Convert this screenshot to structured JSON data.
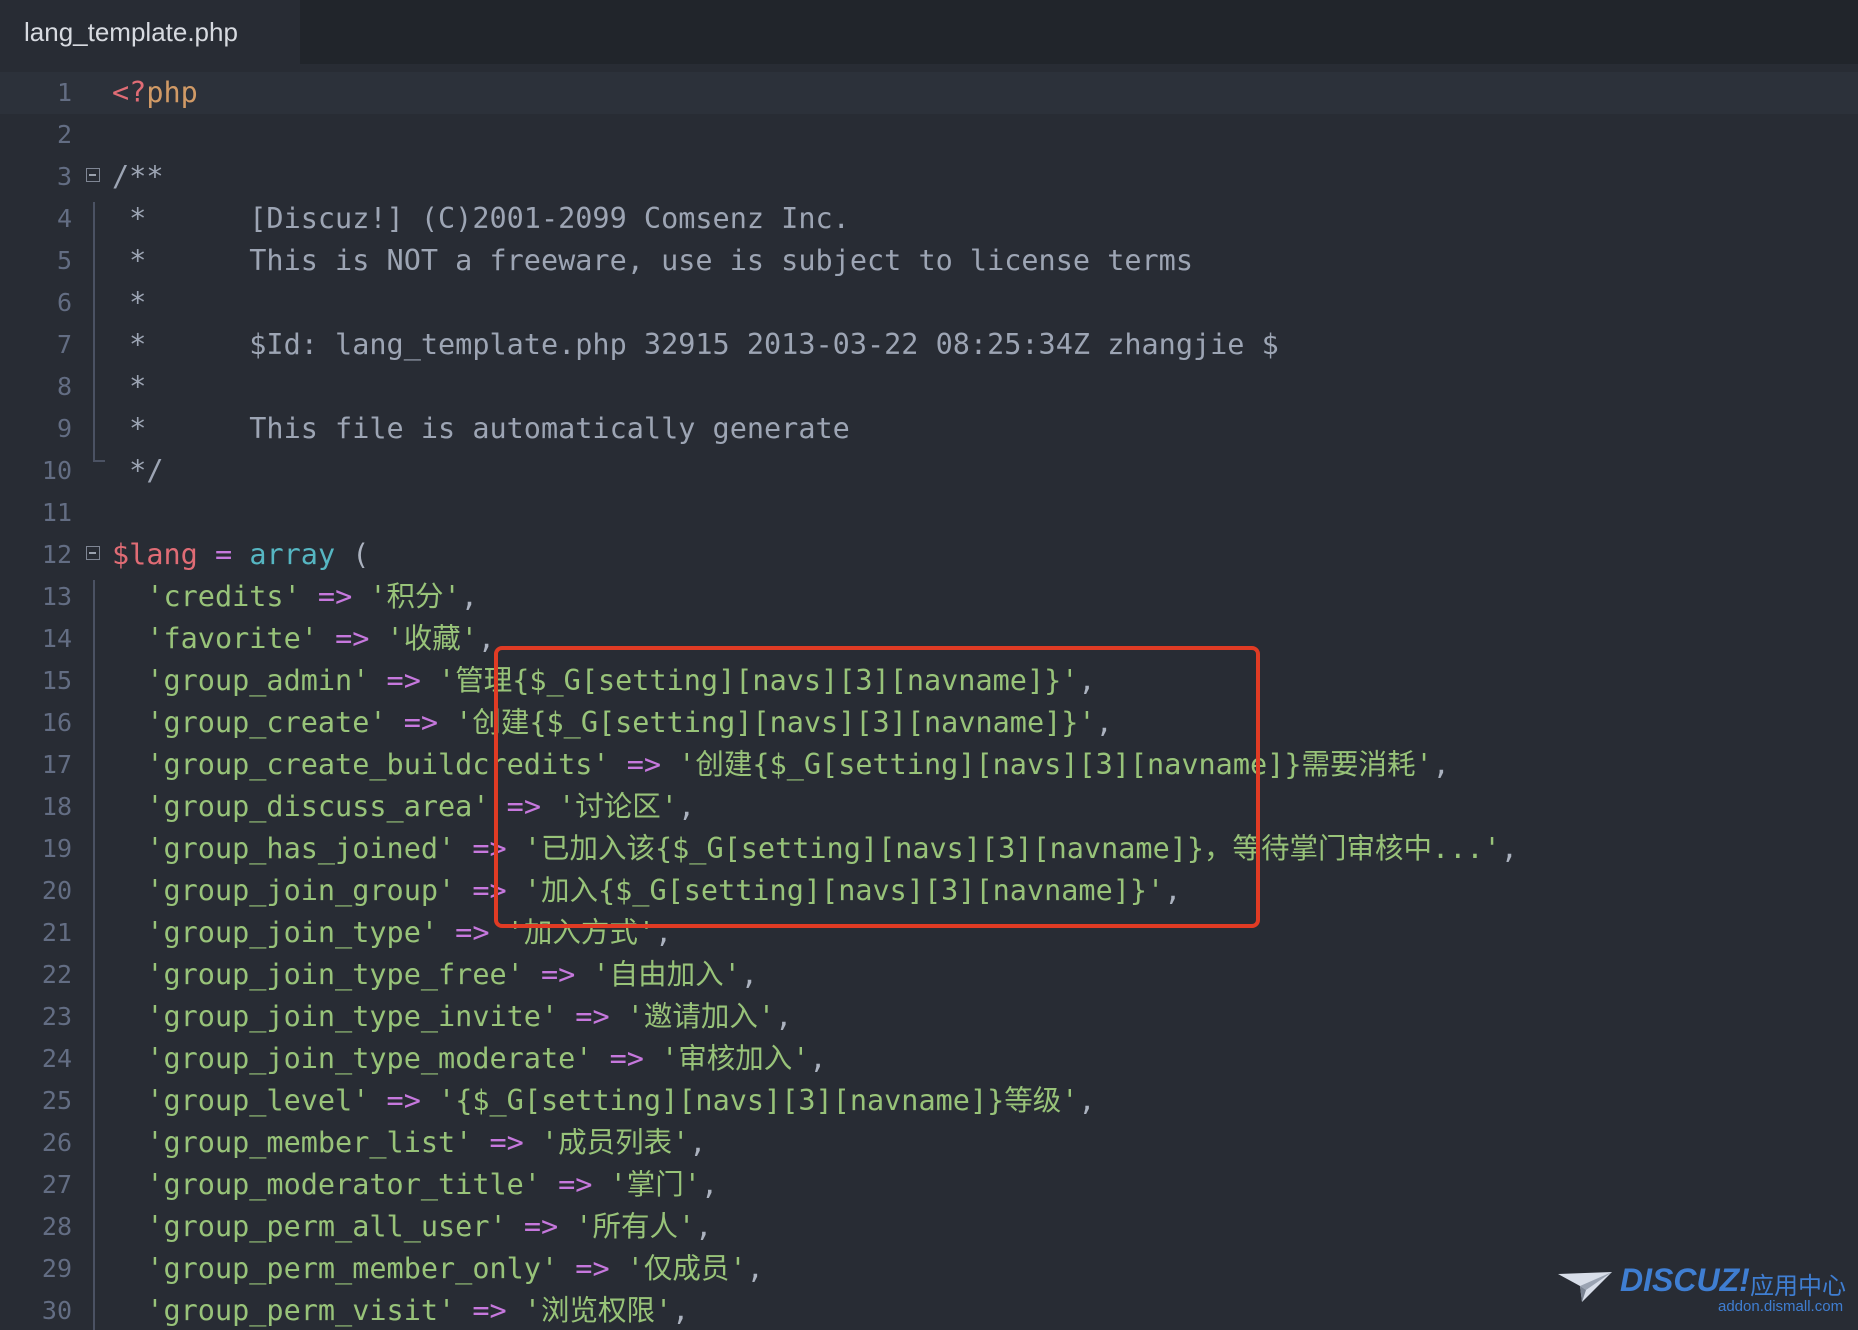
{
  "tab": {
    "filename": "lang_template.php"
  },
  "lines": [
    {
      "n": "1",
      "tokens": [
        {
          "t": "<?",
          "c": "tag"
        },
        {
          "t": "php",
          "c": "kw"
        }
      ]
    },
    {
      "n": "2",
      "tokens": []
    },
    {
      "n": "3",
      "tokens": [
        {
          "t": "/**",
          "c": "cm"
        }
      ]
    },
    {
      "n": "4",
      "tokens": [
        {
          "t": " *      [Discuz!] (C)2001-2099 Comsenz Inc.",
          "c": "cm"
        }
      ]
    },
    {
      "n": "5",
      "tokens": [
        {
          "t": " *      This is NOT a freeware, use is subject to license terms",
          "c": "cm"
        }
      ]
    },
    {
      "n": "6",
      "tokens": [
        {
          "t": " *",
          "c": "cm"
        }
      ]
    },
    {
      "n": "7",
      "tokens": [
        {
          "t": " *      $Id: lang_template.php 32915 2013-03-22 08:25:34Z zhangjie $",
          "c": "cm"
        }
      ]
    },
    {
      "n": "8",
      "tokens": [
        {
          "t": " *",
          "c": "cm"
        }
      ]
    },
    {
      "n": "9",
      "tokens": [
        {
          "t": " *      This file is automatically generate",
          "c": "cm"
        }
      ]
    },
    {
      "n": "10",
      "tokens": [
        {
          "t": " */",
          "c": "cm"
        }
      ]
    },
    {
      "n": "11",
      "tokens": []
    },
    {
      "n": "12",
      "tokens": [
        {
          "t": "$lang",
          "c": "var"
        },
        {
          "t": " ",
          "c": "plain"
        },
        {
          "t": "=",
          "c": "op"
        },
        {
          "t": " ",
          "c": "plain"
        },
        {
          "t": "array",
          "c": "fn"
        },
        {
          "t": " (",
          "c": "plain"
        }
      ]
    },
    {
      "n": "13",
      "tokens": [
        {
          "t": "  'credits'",
          "c": "str"
        },
        {
          "t": " => ",
          "c": "op"
        },
        {
          "t": "'积分'",
          "c": "str"
        },
        {
          "t": ",",
          "c": "plain"
        }
      ]
    },
    {
      "n": "14",
      "tokens": [
        {
          "t": "  'favorite'",
          "c": "str"
        },
        {
          "t": " => ",
          "c": "op"
        },
        {
          "t": "'收藏'",
          "c": "str"
        },
        {
          "t": ",",
          "c": "plain"
        }
      ]
    },
    {
      "n": "15",
      "tokens": [
        {
          "t": "  'group_admin'",
          "c": "str"
        },
        {
          "t": " => ",
          "c": "op"
        },
        {
          "t": "'管理{$_G[setting][navs][3][navname]}'",
          "c": "str"
        },
        {
          "t": ",",
          "c": "plain"
        }
      ]
    },
    {
      "n": "16",
      "tokens": [
        {
          "t": "  'group_create'",
          "c": "str"
        },
        {
          "t": " => ",
          "c": "op"
        },
        {
          "t": "'创建{$_G[setting][navs][3][navname]}'",
          "c": "str"
        },
        {
          "t": ",",
          "c": "plain"
        }
      ]
    },
    {
      "n": "17",
      "tokens": [
        {
          "t": "  'group_create_buildcredits'",
          "c": "str"
        },
        {
          "t": " => ",
          "c": "op"
        },
        {
          "t": "'创建{$_G[setting][navs][3][navname]}需要消耗'",
          "c": "str"
        },
        {
          "t": ",",
          "c": "plain"
        }
      ]
    },
    {
      "n": "18",
      "tokens": [
        {
          "t": "  'group_discuss_area'",
          "c": "str"
        },
        {
          "t": " => ",
          "c": "op"
        },
        {
          "t": "'讨论区'",
          "c": "str"
        },
        {
          "t": ",",
          "c": "plain"
        }
      ]
    },
    {
      "n": "19",
      "tokens": [
        {
          "t": "  'group_has_joined'",
          "c": "str"
        },
        {
          "t": " => ",
          "c": "op"
        },
        {
          "t": "'已加入该{$_G[setting][navs][3][navname]}，等待掌门审核中...'",
          "c": "str"
        },
        {
          "t": ",",
          "c": "plain"
        }
      ]
    },
    {
      "n": "20",
      "tokens": [
        {
          "t": "  'group_join_group'",
          "c": "str"
        },
        {
          "t": " => ",
          "c": "op"
        },
        {
          "t": "'加入{$_G[setting][navs][3][navname]}'",
          "c": "str"
        },
        {
          "t": ",",
          "c": "plain"
        }
      ]
    },
    {
      "n": "21",
      "tokens": [
        {
          "t": "  'group_join_type'",
          "c": "str"
        },
        {
          "t": " => ",
          "c": "op"
        },
        {
          "t": "'加入方式'",
          "c": "str"
        },
        {
          "t": ",",
          "c": "plain"
        }
      ]
    },
    {
      "n": "22",
      "tokens": [
        {
          "t": "  'group_join_type_free'",
          "c": "str"
        },
        {
          "t": " => ",
          "c": "op"
        },
        {
          "t": "'自由加入'",
          "c": "str"
        },
        {
          "t": ",",
          "c": "plain"
        }
      ]
    },
    {
      "n": "23",
      "tokens": [
        {
          "t": "  'group_join_type_invite'",
          "c": "str"
        },
        {
          "t": " => ",
          "c": "op"
        },
        {
          "t": "'邀请加入'",
          "c": "str"
        },
        {
          "t": ",",
          "c": "plain"
        }
      ]
    },
    {
      "n": "24",
      "tokens": [
        {
          "t": "  'group_join_type_moderate'",
          "c": "str"
        },
        {
          "t": " => ",
          "c": "op"
        },
        {
          "t": "'审核加入'",
          "c": "str"
        },
        {
          "t": ",",
          "c": "plain"
        }
      ]
    },
    {
      "n": "25",
      "tokens": [
        {
          "t": "  'group_level'",
          "c": "str"
        },
        {
          "t": " => ",
          "c": "op"
        },
        {
          "t": "'{$_G[setting][navs][3][navname]}等级'",
          "c": "str"
        },
        {
          "t": ",",
          "c": "plain"
        }
      ]
    },
    {
      "n": "26",
      "tokens": [
        {
          "t": "  'group_member_list'",
          "c": "str"
        },
        {
          "t": " => ",
          "c": "op"
        },
        {
          "t": "'成员列表'",
          "c": "str"
        },
        {
          "t": ",",
          "c": "plain"
        }
      ]
    },
    {
      "n": "27",
      "tokens": [
        {
          "t": "  'group_moderator_title'",
          "c": "str"
        },
        {
          "t": " => ",
          "c": "op"
        },
        {
          "t": "'掌门'",
          "c": "str"
        },
        {
          "t": ",",
          "c": "plain"
        }
      ]
    },
    {
      "n": "28",
      "tokens": [
        {
          "t": "  'group_perm_all_user'",
          "c": "str"
        },
        {
          "t": " => ",
          "c": "op"
        },
        {
          "t": "'所有人'",
          "c": "str"
        },
        {
          "t": ",",
          "c": "plain"
        }
      ]
    },
    {
      "n": "29",
      "tokens": [
        {
          "t": "  'group_perm_member_only'",
          "c": "str"
        },
        {
          "t": " => ",
          "c": "op"
        },
        {
          "t": "'仅成员'",
          "c": "str"
        },
        {
          "t": ",",
          "c": "plain"
        }
      ]
    },
    {
      "n": "30",
      "tokens": [
        {
          "t": "  'group_perm_visit'",
          "c": "str"
        },
        {
          "t": " => ",
          "c": "op"
        },
        {
          "t": "'浏览权限'",
          "c": "str"
        },
        {
          "t": ",",
          "c": "plain"
        }
      ]
    }
  ],
  "watermark": {
    "logo": "DISCUZ!",
    "cn": "应用中心",
    "url": "addon.dismall.com"
  },
  "colors": {
    "background": "#282c34",
    "tab_bar": "#21252b",
    "string": "#98c379",
    "operator": "#c678dd",
    "variable": "#e06c75",
    "function": "#56b6c2",
    "keyword": "#d19a66",
    "comment": "#9da5b4",
    "highlight_box": "#e03b24"
  }
}
